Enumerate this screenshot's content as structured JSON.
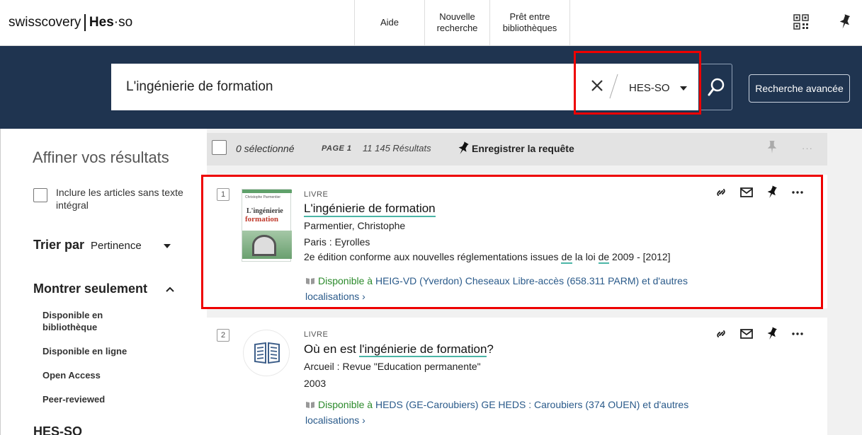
{
  "header": {
    "logo_main": "swisscovery",
    "logo_hes": "Hes",
    "logo_dot": "·",
    "logo_so": "so",
    "nav_aide": "Aide",
    "nav_nouvelle_1": "Nouvelle",
    "nav_nouvelle_2": "recherche",
    "nav_pret_1": "Prêt entre",
    "nav_pret_2": "bibliothèques"
  },
  "search": {
    "query": "L'ingénierie de formation",
    "scope": "HES-SO",
    "advanced": "Recherche avancée"
  },
  "sidebar": {
    "title": "Affiner vos résultats",
    "include_label": "Inclure les articles sans texte intégral",
    "sort_label": "Trier par",
    "sort_value": "Pertinence",
    "show_only": "Montrer seulement",
    "facets": [
      "Disponible en bibliothèque",
      "Disponible en ligne",
      "Open Access",
      "Peer-reviewed"
    ],
    "next_group": "HES-SO"
  },
  "results_header": {
    "selected": "0 sélectionné",
    "page": "PAGE 1",
    "count": "11 145 Résultats",
    "save_query": "Enregistrer la requête",
    "more": "···"
  },
  "results": [
    {
      "number": "1",
      "type": "LIVRE",
      "title": "L'ingénierie de formation",
      "author": "Parmentier, Christophe",
      "publisher": "Paris : Eyrolles",
      "edition_pre": "2e édition conforme aux nouvelles réglementations issues ",
      "edition_de1": "de",
      "edition_mid": " la loi ",
      "edition_de2": "de",
      "edition_post": " 2009 - [2012]",
      "avail_label": "Disponible à",
      "avail_loc": "HEIG-VD (Yverdon) Cheseaux  Libre-accès (658.311 PARM) et d'autres localisations",
      "avail_more": "›",
      "cover_author": "Christophe Parmentier",
      "cover_t1": "L'ingénierie",
      "cover_t2": "formation"
    },
    {
      "number": "2",
      "type": "LIVRE",
      "title_pre": "Où en est ",
      "title_hl": "l'ingénierie de formation",
      "title_post": "?",
      "publisher": "Arcueil : Revue \"Education permanente\"",
      "year": "2003",
      "avail_label": "Disponible à",
      "avail_loc": "HEDS (GE-Caroubiers)  GE HEDS : Caroubiers (374 OUEN) et d'autres localisations",
      "avail_more": "›"
    }
  ],
  "colors": {
    "banner": "#1f3450",
    "highlight_red": "#e00000",
    "available_green": "#2b8a2b",
    "link_blue": "#2a5a8a",
    "underline_teal": "#4bb5a6"
  }
}
